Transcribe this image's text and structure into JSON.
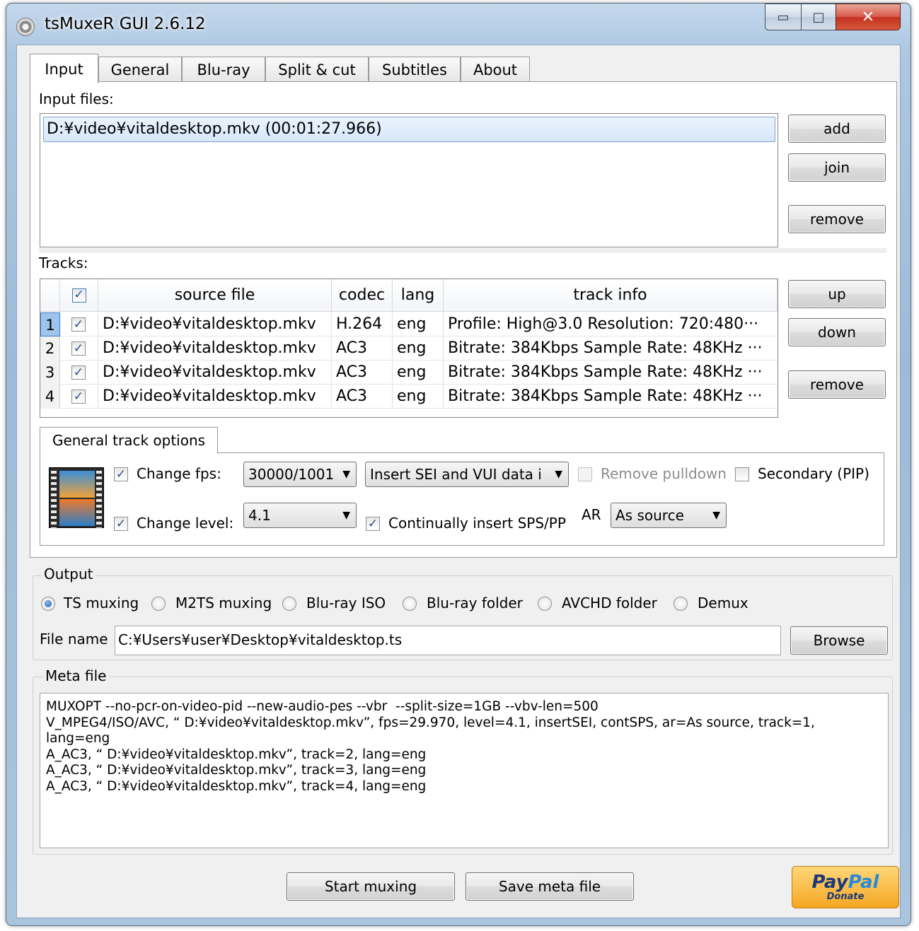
{
  "window": {
    "title": "tsMuxeR GUI 2.6.12",
    "controls": {
      "minimize": "▭",
      "maximize": "□",
      "close": "✕"
    }
  },
  "tabs": [
    {
      "label": "Input",
      "active": true
    },
    {
      "label": "General",
      "active": false
    },
    {
      "label": "Blu-ray",
      "active": false
    },
    {
      "label": "Split & cut",
      "active": false
    },
    {
      "label": "Subtitles",
      "active": false
    },
    {
      "label": "About",
      "active": false
    }
  ],
  "input_files": {
    "label": "Input files:",
    "items": [
      "D:¥video¥vitaldesktop.mkv (00:01:27.966)"
    ],
    "buttons": {
      "add": "add",
      "join": "join",
      "remove": "remove"
    }
  },
  "tracks": {
    "label": "Tracks:",
    "header_checked": true,
    "columns": [
      "source file",
      "codec",
      "lang",
      "track info"
    ],
    "rows": [
      {
        "num": "1",
        "checked": true,
        "source": "D:¥video¥vitaldesktop.mkv",
        "codec": "H.264",
        "lang": "eng",
        "info": "Profile: High@3.0  Resolution: 720:480···",
        "selected": true
      },
      {
        "num": "2",
        "checked": true,
        "source": "D:¥video¥vitaldesktop.mkv",
        "codec": "AC3",
        "lang": "eng",
        "info": "Bitrate: 384Kbps Sample Rate: 48KHz ···",
        "selected": false
      },
      {
        "num": "3",
        "checked": true,
        "source": "D:¥video¥vitaldesktop.mkv",
        "codec": "AC3",
        "lang": "eng",
        "info": "Bitrate: 384Kbps Sample Rate: 48KHz ···",
        "selected": false
      },
      {
        "num": "4",
        "checked": true,
        "source": "D:¥video¥vitaldesktop.mkv",
        "codec": "AC3",
        "lang": "eng",
        "info": "Bitrate: 384Kbps Sample Rate: 48KHz ···",
        "selected": false
      }
    ],
    "buttons": {
      "up": "up",
      "down": "down",
      "remove": "remove"
    }
  },
  "track_options": {
    "tab_label": "General track options",
    "change_fps": {
      "label": "Change fps:",
      "checked": true,
      "value": "30000/1001"
    },
    "sei": {
      "value": "Insert SEI and VUI data i"
    },
    "remove_pulldown": {
      "label": "Remove pulldown",
      "checked": false,
      "enabled": false
    },
    "secondary": {
      "label": "Secondary (PIP)",
      "checked": false
    },
    "change_level": {
      "label": "Change level:",
      "checked": true,
      "value": "4.1"
    },
    "continually": {
      "label": "Continually insert SPS/PP",
      "checked": true
    },
    "ar": {
      "label": "AR",
      "value": "As source"
    }
  },
  "output": {
    "group_label": "Output",
    "modes": [
      {
        "label": "TS muxing",
        "selected": true
      },
      {
        "label": "M2TS muxing",
        "selected": false
      },
      {
        "label": "Blu-ray ISO",
        "selected": false
      },
      {
        "label": "Blu-ray folder",
        "selected": false
      },
      {
        "label": "AVCHD folder",
        "selected": false
      },
      {
        "label": "Demux",
        "selected": false
      }
    ],
    "file_name_label": "File name",
    "file_name": "C:¥Users¥user¥Desktop¥vitaldesktop.ts",
    "browse": "Browse"
  },
  "meta": {
    "group_label": "Meta file",
    "content": "MUXOPT --no-pcr-on-video-pid --new-audio-pes --vbr  --split-size=1GB --vbv-len=500\nV_MPEG4/ISO/AVC, “ D:¥video¥vitaldesktop.mkv”, fps=29.970, level=4.1, insertSEI, contSPS, ar=As source, track=1,\nlang=eng\nA_AC3, “ D:¥video¥vitaldesktop.mkv”, track=2, lang=eng\nA_AC3, “ D:¥video¥vitaldesktop.mkv”, track=3, lang=eng\nA_AC3, “ D:¥video¥vitaldesktop.mkv”, track=4, lang=eng"
  },
  "footer": {
    "start": "Start muxing",
    "save_meta": "Save meta file",
    "paypal": {
      "word1": "Pay",
      "word2": "Pal",
      "sub": "Donate"
    }
  },
  "icons": {
    "check": "✓",
    "dropdown": "▼"
  }
}
